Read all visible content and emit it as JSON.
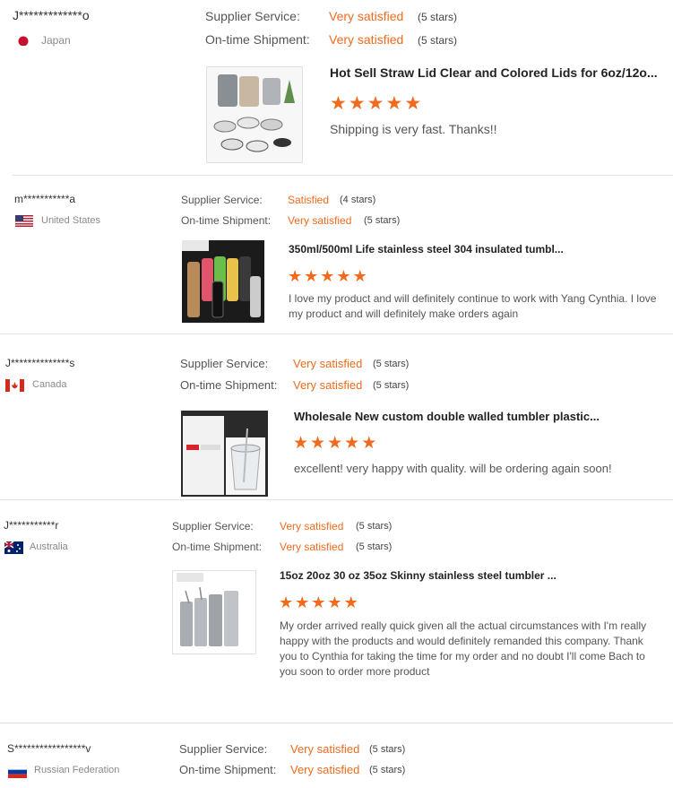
{
  "labels": {
    "supplier": "Supplier Service:",
    "shipment": "On-time Shipment:"
  },
  "reviews": [
    {
      "user": "J*************o",
      "country": "Japan",
      "flag": "japan-flag",
      "supplier_rating": "Very satisfied",
      "supplier_stars": "(5 stars)",
      "shipment_rating": "Very satisfied",
      "shipment_stars": "(5 stars)",
      "product_title": "Hot Sell Straw Lid Clear and Colored Lids for 6oz/12o...",
      "stars": 5,
      "comment": "Shipping is very fast. Thanks!!"
    },
    {
      "user": "m***********a",
      "country": "United States",
      "flag": "usa-flag",
      "supplier_rating": "Satisfied",
      "supplier_stars": "(4 stars)",
      "shipment_rating": "Very satisfied",
      "shipment_stars": "(5 stars)",
      "product_title": "350ml/500ml Life stainless steel 304 insulated tumbl...",
      "stars": 5,
      "comment": "I love my product and will definitely continue to work with Yang Cynthia. I love my product and will definitely make orders again"
    },
    {
      "user": "J**************s",
      "country": "Canada",
      "flag": "canada-flag",
      "supplier_rating": "Very satisfied",
      "supplier_stars": "(5 stars)",
      "shipment_rating": "Very satisfied",
      "shipment_stars": "(5 stars)",
      "product_title": "Wholesale New custom double walled tumbler plastic...",
      "stars": 5,
      "comment": "excellent! very happy with quality. will be ordering again soon!"
    },
    {
      "user": "J***********r",
      "country": "Australia",
      "flag": "australia-flag",
      "supplier_rating": "Very satisfied",
      "supplier_stars": "(5 stars)",
      "shipment_rating": "Very satisfied",
      "shipment_stars": "(5 stars)",
      "product_title": "15oz 20oz 30 oz 35oz Skinny stainless steel tumbler ...",
      "stars": 5,
      "comment": "My order arrived really quick given all the actual circumstances with I'm really happy with the products and would definitely remanded this company. Thank you to Cynthia for taking the time for my order and no doubt I'll come Bach to you soon to order more product"
    },
    {
      "user": "S*****************v",
      "country": "Russian Federation",
      "flag": "russia-flag",
      "supplier_rating": "Very satisfied",
      "supplier_stars": "(5 stars)",
      "shipment_rating": "Very satisfied",
      "shipment_stars": "(5 stars)"
    }
  ]
}
